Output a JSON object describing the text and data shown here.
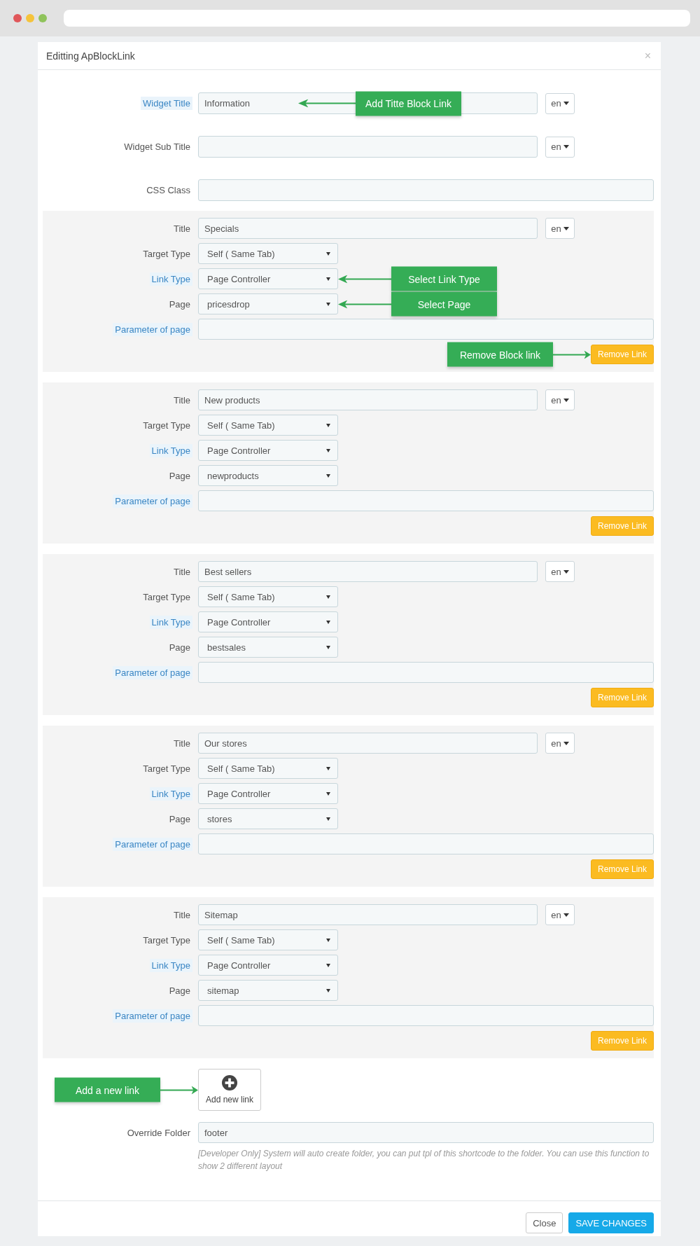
{
  "modal": {
    "title": "Editting ApBlockLink",
    "close": "×"
  },
  "fields": [
    {
      "kind": "text-lang",
      "label": "Widget Title",
      "highlighted": true,
      "value": "Information",
      "lang": "en",
      "callout": {
        "text": "Add Titte Block Link",
        "kind": "inside"
      }
    },
    {
      "kind": "text-lang",
      "label": "Widget Sub Title",
      "highlighted": false,
      "lang": "en"
    },
    {
      "kind": "text",
      "label": "CSS Class",
      "highlighted": false
    }
  ],
  "links": [
    {
      "rows": [
        {
          "kind": "text-lang",
          "label": "Title",
          "highlighted": false,
          "value": "Specials",
          "lang": "en"
        },
        {
          "kind": "select",
          "label": "Target Type",
          "highlighted": false,
          "value": "Self ( Same Tab)"
        },
        {
          "kind": "select",
          "label": "Link Type",
          "highlighted": true,
          "value": "Page Controller",
          "callout": {
            "text": "Select Link Type",
            "kind": "after"
          }
        },
        {
          "kind": "select",
          "label": "Page",
          "highlighted": false,
          "value": "pricesdrop",
          "callout": {
            "text": "Select Page",
            "kind": "after"
          }
        },
        {
          "kind": "text",
          "label": "Parameter of page",
          "highlighted": true
        }
      ],
      "remove_button": "Remove Link",
      "callout": {
        "text": "Remove Block link",
        "kind": "before"
      }
    },
    {
      "rows": [
        {
          "kind": "text-lang",
          "label": "Title",
          "highlighted": false,
          "value": "New products",
          "lang": "en"
        },
        {
          "kind": "select",
          "label": "Target Type",
          "highlighted": false,
          "value": "Self ( Same Tab)"
        },
        {
          "kind": "select",
          "label": "Link Type",
          "highlighted": true,
          "value": "Page Controller"
        },
        {
          "kind": "select",
          "label": "Page",
          "highlighted": false,
          "value": "newproducts"
        },
        {
          "kind": "text",
          "label": "Parameter of page",
          "highlighted": true
        }
      ],
      "remove_button": "Remove Link"
    },
    {
      "rows": [
        {
          "kind": "text-lang",
          "label": "Title",
          "highlighted": false,
          "value": "Best sellers",
          "lang": "en"
        },
        {
          "kind": "select",
          "label": "Target Type",
          "highlighted": false,
          "value": "Self ( Same Tab)"
        },
        {
          "kind": "select",
          "label": "Link Type",
          "highlighted": true,
          "value": "Page Controller"
        },
        {
          "kind": "select",
          "label": "Page",
          "highlighted": false,
          "value": "bestsales"
        },
        {
          "kind": "text",
          "label": "Parameter of page",
          "highlighted": true
        }
      ],
      "remove_button": "Remove Link"
    },
    {
      "rows": [
        {
          "kind": "text-lang",
          "label": "Title",
          "highlighted": false,
          "value": "Our stores",
          "lang": "en"
        },
        {
          "kind": "select",
          "label": "Target Type",
          "highlighted": false,
          "value": "Self ( Same Tab)"
        },
        {
          "kind": "select",
          "label": "Link Type",
          "highlighted": true,
          "value": "Page Controller"
        },
        {
          "kind": "select",
          "label": "Page",
          "highlighted": false,
          "value": "stores"
        },
        {
          "kind": "text",
          "label": "Parameter of page",
          "highlighted": true
        }
      ],
      "remove_button": "Remove Link"
    },
    {
      "rows": [
        {
          "kind": "text-lang",
          "label": "Title",
          "highlighted": false,
          "value": "Sitemap",
          "lang": "en"
        },
        {
          "kind": "select",
          "label": "Target Type",
          "highlighted": false,
          "value": "Self ( Same Tab)"
        },
        {
          "kind": "select",
          "label": "Link Type",
          "highlighted": true,
          "value": "Page Controller"
        },
        {
          "kind": "select",
          "label": "Page",
          "highlighted": false,
          "value": "sitemap"
        },
        {
          "kind": "text",
          "label": "Parameter of page",
          "highlighted": true
        }
      ],
      "remove_button": "Remove Link"
    }
  ],
  "add_button": {
    "label": "Add new link",
    "callout": {
      "text": "Add a new link",
      "kind": "before"
    }
  },
  "override_folder": {
    "label": "Override Folder",
    "value": "footer",
    "help": "[Developer Only] System will auto create folder, you can put tpl of this shortcode to the folder. You can use this function to show 2 different layout"
  },
  "footer": {
    "buttons": [
      {
        "label": "Close",
        "kind": "default"
      },
      {
        "label": "SAVE CHANGES",
        "kind": "primary"
      }
    ]
  }
}
